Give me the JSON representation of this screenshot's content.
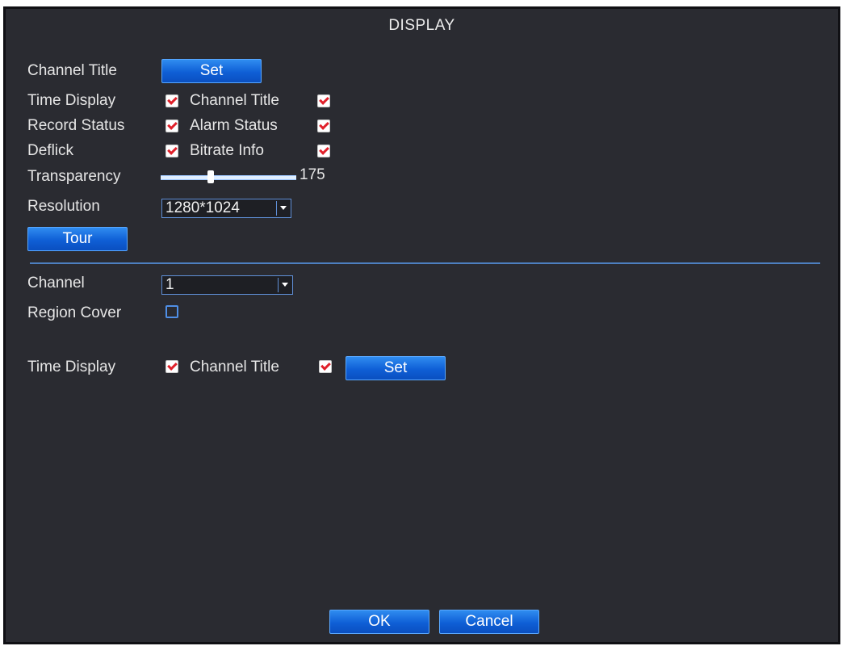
{
  "window": {
    "title": "DISPLAY"
  },
  "gui": {
    "channel_title_label": "Channel Title",
    "channel_title_set": "Set",
    "time_display_label": "Time Display",
    "time_display_checked": true,
    "channel_title_cb_label": "Channel Title",
    "channel_title_checked": true,
    "record_status_label": "Record Status",
    "record_status_checked": true,
    "alarm_status_label": "Alarm Status",
    "alarm_status_checked": true,
    "deflick_label": "Deflick",
    "deflick_checked": true,
    "bitrate_info_label": "Bitrate Info",
    "bitrate_info_checked": true,
    "transparency_label": "Transparency",
    "transparency_value": "175",
    "transparency_fraction": 0.37,
    "resolution_label": "Resolution",
    "resolution_value": "1280*1024",
    "tour_button": "Tour"
  },
  "channel_section": {
    "channel_label": "Channel",
    "channel_value": "1",
    "region_cover_label": "Region Cover",
    "region_cover_checked": false,
    "time_display_label": "Time Display",
    "time_display_checked": true,
    "channel_title_label": "Channel Title",
    "channel_title_checked": true,
    "set_button": "Set"
  },
  "footer": {
    "ok_button": "OK",
    "cancel_button": "Cancel"
  }
}
